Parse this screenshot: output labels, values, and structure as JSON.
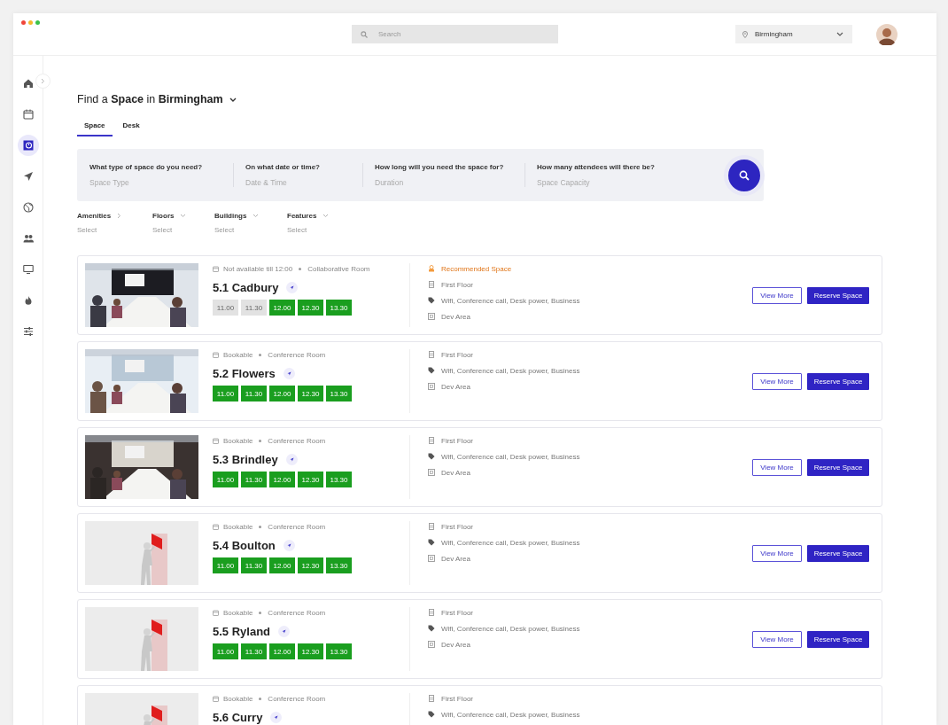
{
  "topbar": {
    "search": {
      "placeholder": "Search"
    },
    "location": "Birmingham"
  },
  "sidebar": {
    "items": [
      {
        "selected": false
      },
      {
        "selected": false
      },
      {
        "selected": true
      },
      {
        "selected": false
      },
      {
        "selected": false
      },
      {
        "selected": false
      },
      {
        "selected": false
      },
      {
        "selected": false
      },
      {
        "selected": false
      }
    ]
  },
  "title": "Find a **Space** in **Birmingham**",
  "tabs": [
    {
      "label": "Space",
      "selected": true
    },
    {
      "label": "Desk",
      "selected": false
    }
  ],
  "search_panel": {
    "fields": [
      {
        "label": "What type of space do you need?",
        "placeholder": "Space Type"
      },
      {
        "label": "On what date or time?",
        "placeholder": "Date & Time"
      },
      {
        "label": "How long will you need the space for?",
        "placeholder": "Duration"
      },
      {
        "label": "How many attendees will there be?",
        "placeholder": "Space Capacity"
      }
    ]
  },
  "filters": [
    {
      "label": "Amenities",
      "value": "Select"
    },
    {
      "label": "Floors",
      "value": "Select"
    },
    {
      "label": "Buildings",
      "value": "Select"
    },
    {
      "label": "Features",
      "value": "Select"
    }
  ],
  "spaces": [
    {
      "status": "Not available till 12:00",
      "room_type": "Collaborative Room",
      "name": "5.1 Cadbury",
      "slots": [
        {
          "time": "11.00",
          "available": false
        },
        {
          "time": "11.30",
          "available": false
        },
        {
          "time": "12.00",
          "available": true
        },
        {
          "time": "12.30",
          "available": true
        },
        {
          "time": "13.30",
          "available": true
        }
      ],
      "badge": "Recommended Space",
      "floor": "First Floor",
      "amenities": "Wifi, Conference call, Desk power, Business",
      "area": "Dev Area",
      "buttons": [
        "View More",
        "Reserve Space"
      ]
    },
    {
      "status": "Bookable",
      "room_type": "Conference Room",
      "name": "5.2 Flowers",
      "slots": [
        {
          "time": "11.00",
          "available": true
        },
        {
          "time": "11.30",
          "available": true
        },
        {
          "time": "12.00",
          "available": true
        },
        {
          "time": "12.30",
          "available": true
        },
        {
          "time": "13.30",
          "available": true
        }
      ],
      "floor": "First Floor",
      "amenities": "Wifi, Conference call, Desk power, Business",
      "area": "Dev Area",
      "buttons": [
        "View More",
        "Reserve Space"
      ]
    },
    {
      "status": "Bookable",
      "room_type": "Conference Room",
      "name": "5.3 Brindley",
      "slots": [
        {
          "time": "11.00",
          "available": true
        },
        {
          "time": "11.30",
          "available": true
        },
        {
          "time": "12.00",
          "available": true
        },
        {
          "time": "12.30",
          "available": true
        },
        {
          "time": "13.30",
          "available": true
        }
      ],
      "floor": "First Floor",
      "amenities": "Wifi, Conference call, Desk power, Business",
      "area": "Dev Area",
      "buttons": [
        "View More",
        "Reserve Space"
      ]
    },
    {
      "status": "Bookable",
      "room_type": "Conference Room",
      "name": "5.4 Boulton",
      "slots": [
        {
          "time": "11.00",
          "available": true
        },
        {
          "time": "11.30",
          "available": true
        },
        {
          "time": "12.00",
          "available": true
        },
        {
          "time": "12.30",
          "available": true
        },
        {
          "time": "13.30",
          "available": true
        }
      ],
      "floor": "First Floor",
      "amenities": "Wifi, Conference call, Desk power, Business",
      "area": "Dev Area",
      "buttons": [
        "View More",
        "Reserve Space"
      ]
    },
    {
      "status": "Bookable",
      "room_type": "Conference Room",
      "name": "5.5 Ryland",
      "slots": [
        {
          "time": "11.00",
          "available": true
        },
        {
          "time": "11.30",
          "available": true
        },
        {
          "time": "12.00",
          "available": true
        },
        {
          "time": "12.30",
          "available": true
        },
        {
          "time": "13.30",
          "available": true
        }
      ],
      "floor": "First Floor",
      "amenities": "Wifi, Conference call, Desk power, Business",
      "area": "Dev Area",
      "buttons": [
        "View More",
        "Reserve Space"
      ]
    },
    {
      "status": "Bookable",
      "room_type": "Conference Room",
      "name": "5.6 Curry",
      "floor": "First Floor",
      "amenities": "Wifi, Conference call, Desk power, Business"
    }
  ]
}
